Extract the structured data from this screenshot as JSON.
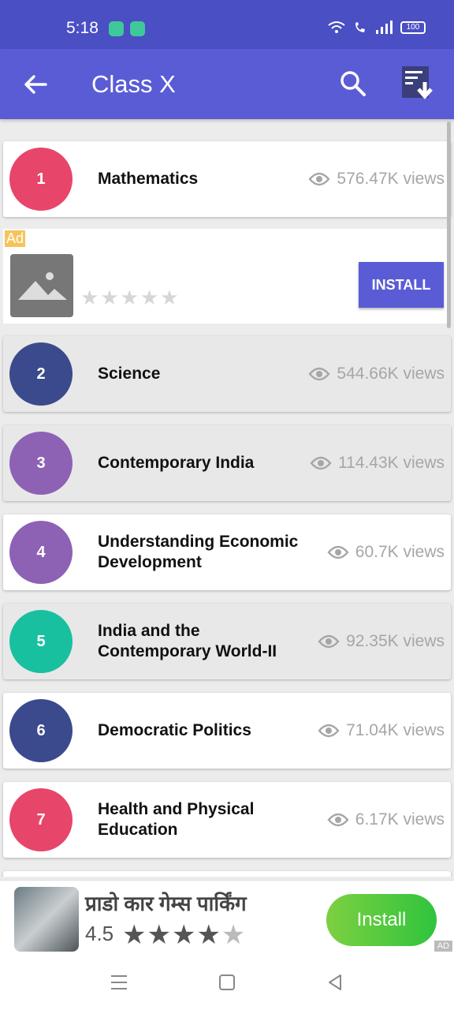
{
  "status_bar": {
    "time": "5:18",
    "battery": "100"
  },
  "app_bar": {
    "title": "Class X"
  },
  "subjects": [
    {
      "number": "1",
      "name": "Mathematics",
      "views": "576.47K views",
      "color": "#e8456a"
    },
    {
      "number": "2",
      "name": "Science",
      "views": "544.66K views",
      "color": "#3a4a8c"
    },
    {
      "number": "3",
      "name": "Contemporary India",
      "views": "114.43K views",
      "color": "#8d62b5"
    },
    {
      "number": "4",
      "name": "Understanding Economic Development",
      "views": "60.7K views",
      "color": "#8d62b5"
    },
    {
      "number": "5",
      "name": "India and the Contemporary World-II",
      "views": "92.35K views",
      "color": "#19c0a0"
    },
    {
      "number": "6",
      "name": "Democratic Politics",
      "views": "71.04K views",
      "color": "#3a4a8c"
    },
    {
      "number": "7",
      "name": "Health and Physical Education",
      "views": "6.17K views",
      "color": "#e8456a"
    }
  ],
  "native_ad": {
    "label": "Ad",
    "install_label": "INSTALL"
  },
  "bottom_ad": {
    "title": "प्राडो कार गेम्स पार्किंग",
    "rating": "4.5",
    "install_label": "Install",
    "corner_label": "AD"
  }
}
